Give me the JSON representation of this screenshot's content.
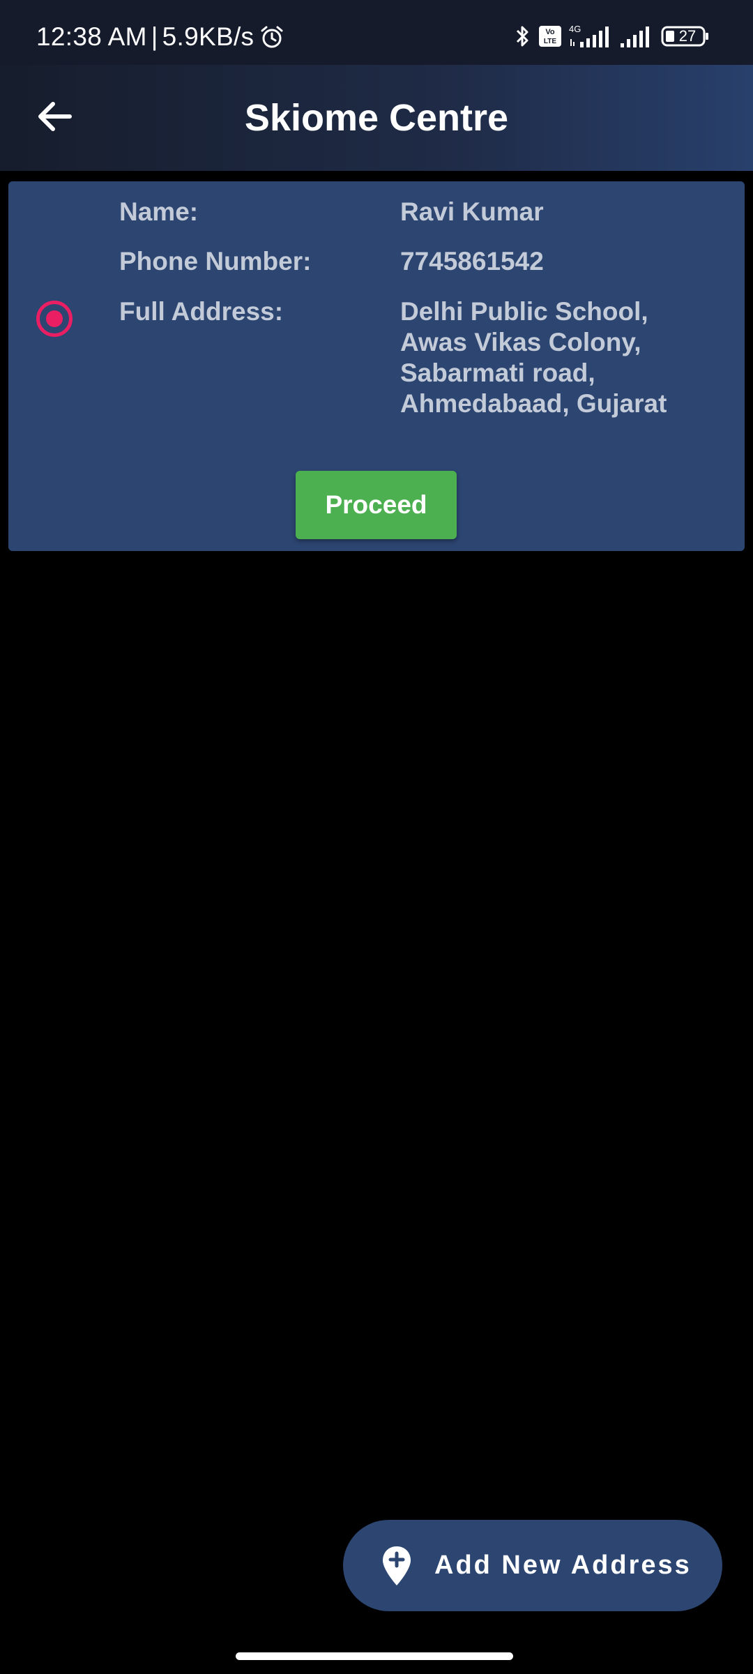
{
  "status_bar": {
    "time": "12:38 AM",
    "separator": "|",
    "network_speed": "5.9KB/s",
    "network_type": "4G",
    "volte": "Vo LTE",
    "battery": "27",
    "icons": [
      "alarm-icon",
      "bluetooth-icon",
      "volte-icon",
      "signal-icon",
      "signal-icon",
      "battery-icon"
    ]
  },
  "header": {
    "title": "Skiome Centre",
    "back_icon": "arrow-left-icon"
  },
  "address_card": {
    "selected": true,
    "name_label": "Name:",
    "name_value": "Ravi Kumar",
    "phone_label": "Phone Number:",
    "phone_value": "7745861542",
    "address_label": "Full Address:",
    "address_lines": [
      "Delhi Public School,",
      "Awas Vikas Colony,",
      "Sabarmati road,",
      "Ahmedabaad, Gujarat"
    ],
    "proceed_label": "Proceed"
  },
  "fab": {
    "label": "Add New Address",
    "icon": "add-location-icon"
  },
  "colors": {
    "status_bar_bg": "#151b2a",
    "card_bg": "#2c4571",
    "card_text": "#c3cad8",
    "radio_accent": "#e91e63",
    "proceed_bg": "#4caf50",
    "page_bg": "#000000"
  }
}
